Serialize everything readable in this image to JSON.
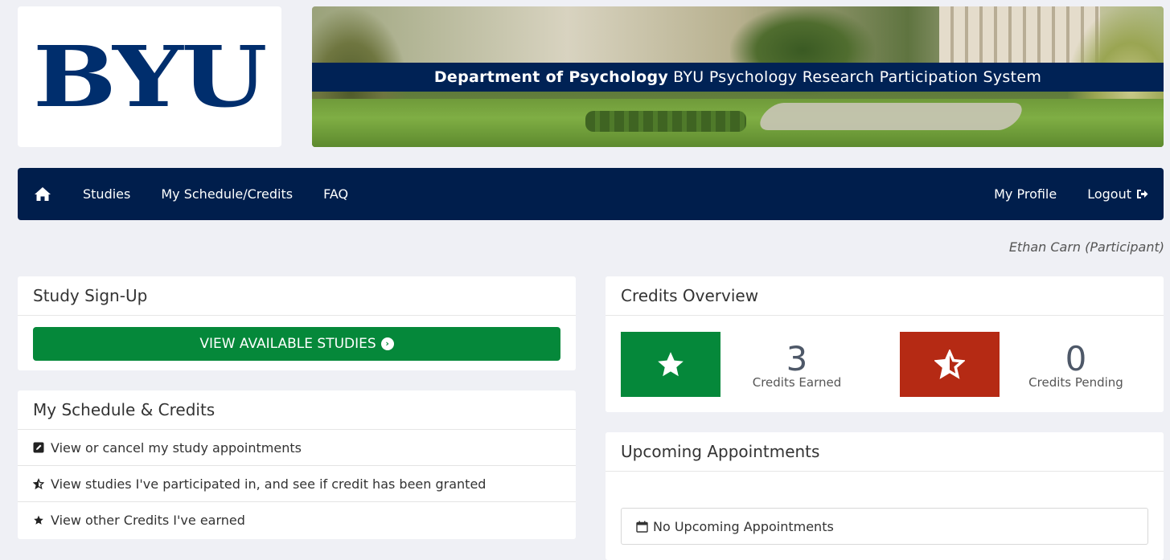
{
  "logo": {
    "text": "BYU"
  },
  "banner": {
    "dept": "Department of Psychology",
    "system": "BYU Psychology Research Participation System"
  },
  "nav": {
    "items": [
      {
        "label": "Studies"
      },
      {
        "label": "My Schedule/Credits"
      },
      {
        "label": "FAQ"
      }
    ],
    "profile": "My Profile",
    "logout": "Logout"
  },
  "user": {
    "display": "Ethan Carn (Participant)"
  },
  "signup": {
    "title": "Study Sign-Up",
    "button": "VIEW AVAILABLE STUDIES"
  },
  "schedule": {
    "title": "My Schedule & Credits",
    "items": [
      {
        "label": "View or cancel my study appointments",
        "icon": "edit-icon"
      },
      {
        "label": "View studies I've participated in, and see if credit has been granted",
        "icon": "star-half-icon"
      },
      {
        "label": "View other Credits I've earned",
        "icon": "star-icon"
      }
    ]
  },
  "credits": {
    "title": "Credits Overview",
    "earned": {
      "value": "3",
      "label": "Credits Earned",
      "color": "#05883a"
    },
    "pending": {
      "value": "0",
      "label": "Credits Pending",
      "color": "#b52a14"
    }
  },
  "upcoming": {
    "title": "Upcoming Appointments",
    "empty": "No Upcoming Appointments"
  },
  "colors": {
    "nav": "#001e4c",
    "brand": "#002e6d",
    "page_bg": "#eff0f5"
  }
}
